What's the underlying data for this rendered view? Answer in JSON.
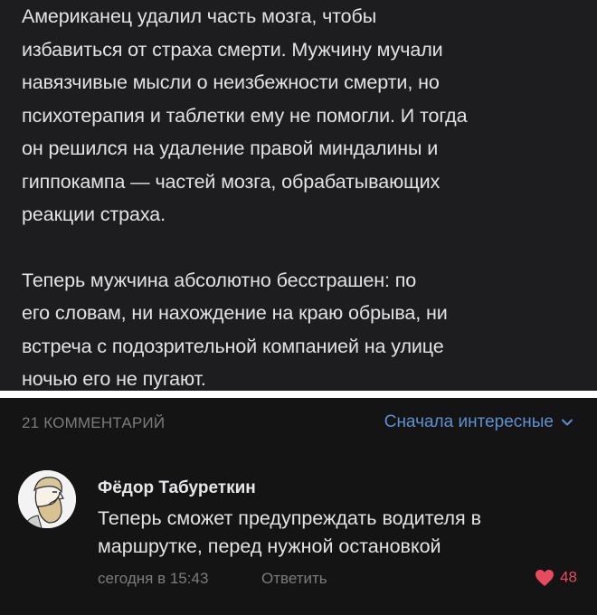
{
  "post": {
    "paragraphs": [
      "Американец удалил часть мозга, чтобы\nизбавиться от страха смерти. Мужчину мучали\nнавязчивые мысли о неизбежности смерти, но\nпсихотерапия и таблетки ему не помогли. И тогда\nон решился на удаление правой миндалины и\nгиппокампа — частей мозга, обрабатывающих\nреакции страха.",
      "Теперь мужчина абсолютно бесстрашен: по\nего словам, ни нахождение на краю обрыва, ни\nвстреча с подозрительной компанией на улице\nночью его не пугают."
    ]
  },
  "comments_section": {
    "count_label": "21 КОММЕНТАРИЙ",
    "sort_label": "Сначала интересные",
    "comment": {
      "author": "Фёдор Табуреткин",
      "text": "Теперь сможет предупреждать водителя в\nмаршрутке, перед нужной остановкой",
      "timestamp": "сегодня в 15:43",
      "reply_label": "Ответить",
      "likes": "48"
    }
  },
  "colors": {
    "post_background": "#1d1d1f",
    "comments_background": "#141415",
    "accent_blue": "#5e8fce",
    "like_red": "#e84a5f",
    "muted_text": "#7c7c80"
  }
}
